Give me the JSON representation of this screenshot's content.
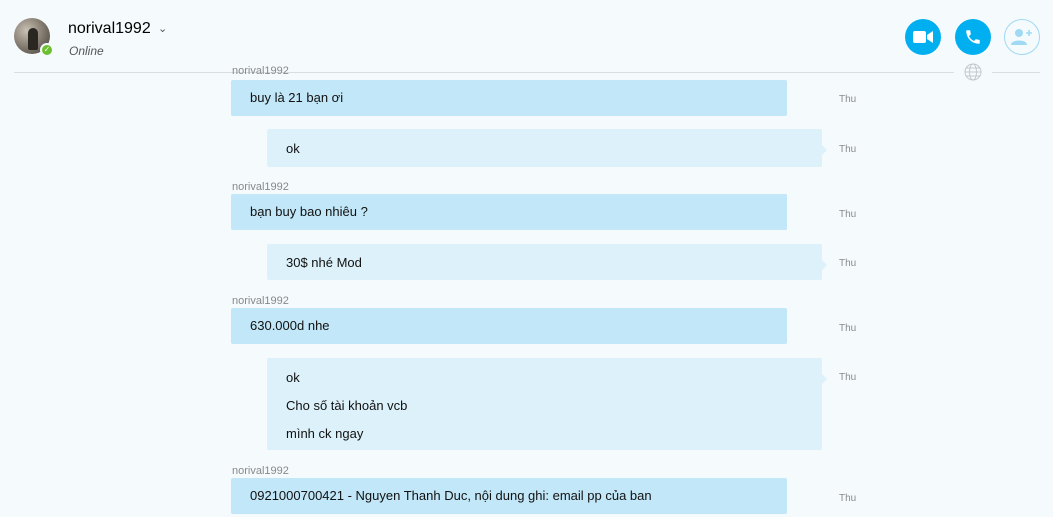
{
  "header": {
    "contact_name": "norival1992",
    "status": "Online",
    "presence_mark": "✓",
    "buttons": [
      "video-call-icon",
      "audio-call-icon",
      "add-people-icon"
    ],
    "accent_color": "#00aff0"
  },
  "messages": [
    {
      "sender": "norival1992",
      "lines": [
        "buy là 21 bạn ơi"
      ],
      "time": "Thu",
      "direction": "in"
    },
    {
      "sender": "",
      "lines": [
        "ok"
      ],
      "time": "Thu",
      "direction": "out"
    },
    {
      "sender": "norival1992",
      "lines": [
        "bạn buy bao nhiêu ?"
      ],
      "time": "Thu",
      "direction": "in"
    },
    {
      "sender": "",
      "lines": [
        "30$ nhé Mod"
      ],
      "time": "Thu",
      "direction": "out"
    },
    {
      "sender": "norival1992",
      "lines": [
        "630.000d nhe"
      ],
      "time": "Thu",
      "direction": "in"
    },
    {
      "sender": "",
      "lines": [
        "ok",
        "Cho số tài khoản vcb",
        "mình ck ngay"
      ],
      "time": "Thu",
      "direction": "out"
    },
    {
      "sender": "norival1992",
      "lines": [
        "0921000700421 - Nguyen Thanh Duc, nội dung ghi: email pp của ban"
      ],
      "time": "Thu",
      "direction": "in"
    }
  ]
}
